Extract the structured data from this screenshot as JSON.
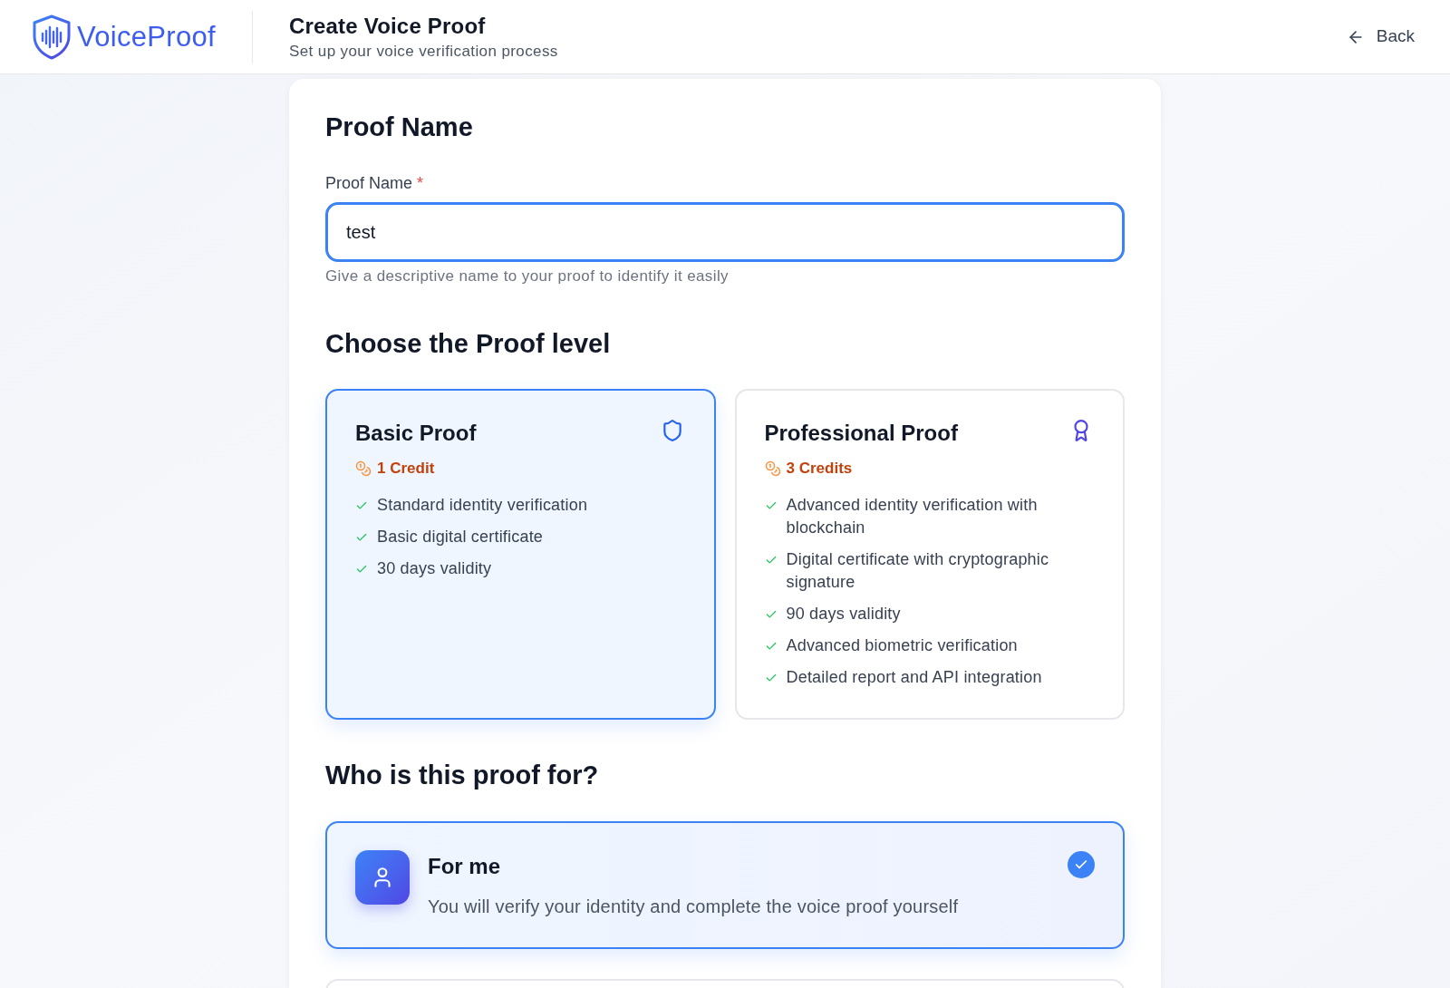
{
  "header": {
    "logo_text": "VoiceProof",
    "title": "Create Voice Proof",
    "subtitle": "Set up your voice verification process",
    "back_link": "Back"
  },
  "proof_name": {
    "heading": "Proof Name",
    "label": "Proof Name",
    "required_mark": "*",
    "value": "test",
    "focused": true,
    "helper": "Give a descriptive name to your proof to identify it easily"
  },
  "proof_level": {
    "heading": "Choose the Proof level",
    "options": [
      {
        "kind": "basic",
        "title": "Basic Proof",
        "credits": "1 Credit",
        "selected": true,
        "features": [
          "Standard identity verification",
          "Basic digital certificate",
          "30 days validity"
        ]
      },
      {
        "kind": "professional",
        "title": "Professional Proof",
        "credits": "3 Credits",
        "selected": false,
        "features": [
          "Advanced identity verification with blockchain",
          "Digital certificate with cryptographic signature",
          "90 days validity",
          "Advanced biometric verification",
          "Detailed report and API integration"
        ]
      }
    ]
  },
  "recipient": {
    "heading": "Who is this proof for?",
    "options": [
      {
        "kind": "self",
        "title": "For me",
        "description": "You will verify your identity and complete the voice proof yourself",
        "selected": true
      }
    ]
  }
}
